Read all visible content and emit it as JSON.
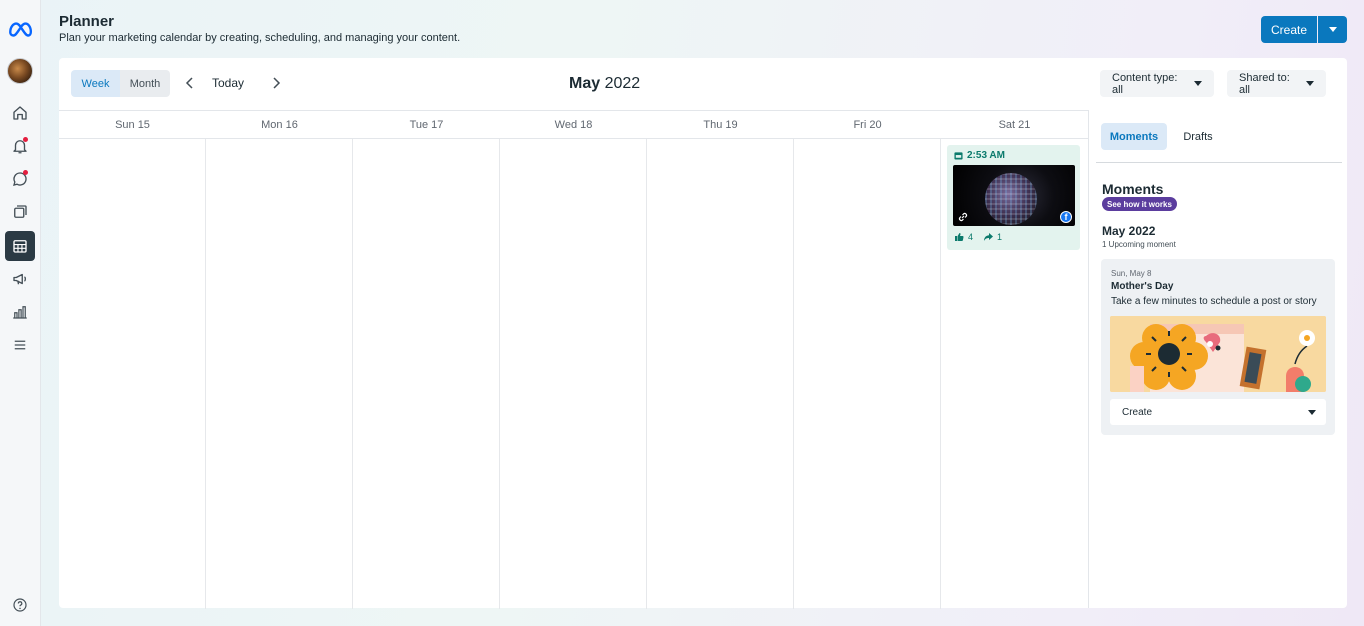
{
  "header": {
    "title": "Planner",
    "subtitle": "Plan your marketing calendar by creating, scheduling, and managing your content.",
    "create_label": "Create"
  },
  "rail": {
    "icons": [
      "meta-logo-icon",
      "avatar",
      "home-icon",
      "notifications-icon",
      "messages-icon",
      "content-icon",
      "planner-icon",
      "ads-icon",
      "insights-icon",
      "menu-icon",
      "help-icon"
    ]
  },
  "toolbar": {
    "week_label": "Week",
    "month_label": "Month",
    "today_label": "Today",
    "month_name": "May",
    "year": "2022",
    "content_type_label": "Content type: all",
    "shared_to_label": "Shared to: all"
  },
  "calendar": {
    "days": [
      "Sun 15",
      "Mon 16",
      "Tue 17",
      "Wed 18",
      "Thu 19",
      "Fri 20",
      "Sat 21"
    ],
    "post": {
      "time": "2:53 AM",
      "likes": "4",
      "shares": "1"
    }
  },
  "sidebar": {
    "tabs": [
      "Moments",
      "Drafts"
    ],
    "heading": "Moments",
    "see_how": "See how it works",
    "month_heading": "May 2022",
    "upcoming": "1 Upcoming moment",
    "moment": {
      "date": "Sun, May 8",
      "title": "Mother's Day",
      "description": "Take a few minutes to schedule a post or story",
      "create_label": "Create"
    }
  },
  "colors": {
    "accent": "#0a78be",
    "post_bg": "#e3f3ee",
    "post_text": "#0b7a6c",
    "see_how_bg": "#5b3d9e"
  }
}
